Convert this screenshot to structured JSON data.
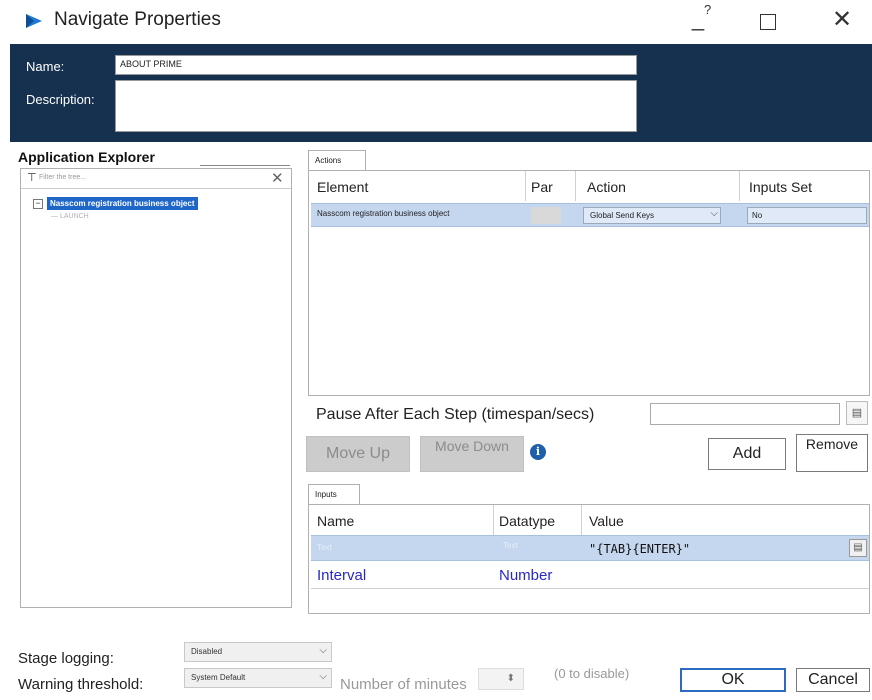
{
  "window": {
    "title": "Navigate Properties",
    "help_glyph": "?",
    "minimize_glyph": "_",
    "close_glyph": "✕"
  },
  "header": {
    "name_label": "Name:",
    "name_value": "ABOUT PRIME",
    "description_label": "Description:",
    "description_value": ""
  },
  "app_explorer": {
    "title": "Application Explorer",
    "filter_placeholder": "Filter the tree...",
    "clear_glyph": "✕",
    "expander_glyph": "−",
    "root": "Nasscom registration business object",
    "child": "LAUNCH"
  },
  "actions": {
    "tab_label": "Actions",
    "columns": [
      "Element",
      "Par",
      "Action",
      "Inputs Set"
    ],
    "rows": [
      {
        "element": "Nasscom registration business object",
        "par": "",
        "action": "Global Send Keys",
        "inputs_set": "No"
      }
    ]
  },
  "pause": {
    "label": "Pause After Each Step (timespan/secs)",
    "value": ""
  },
  "buttons": {
    "move_up": "Move Up",
    "move_down": "Move Down",
    "add": "Add",
    "remove": "Remove",
    "ok": "OK",
    "cancel": "Cancel"
  },
  "inputs": {
    "tab_label": "Inputs",
    "columns": [
      "Name",
      "Datatype",
      "Value"
    ],
    "rows": [
      {
        "name": "Text",
        "datatype": "Text",
        "value": "\"{TAB}{ENTER}\""
      },
      {
        "name": "Interval",
        "datatype": "Number",
        "value": ""
      }
    ]
  },
  "bottom": {
    "stage_logging_label": "Stage logging:",
    "stage_logging_value": "Disabled",
    "warning_label": "Warning threshold:",
    "warning_value": "System Default",
    "minutes_label": "Number of minutes",
    "disable_note": "(0 to disable)"
  },
  "colors": {
    "header_bg": "#16304f",
    "selection": "#1f66c9",
    "row_highlight": "#c5d7ef",
    "link_text": "#2828c8"
  }
}
